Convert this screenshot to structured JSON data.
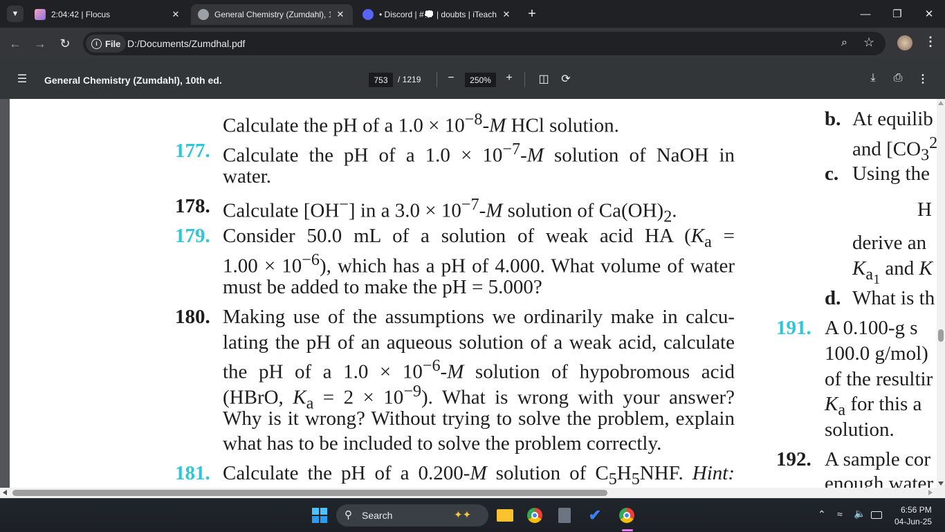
{
  "browser": {
    "tabs": [
      {
        "title": "2:04:42 | Flocus",
        "active": false
      },
      {
        "title": "General Chemistry (Zumdahl), 1",
        "active": true
      },
      {
        "title": "• Discord | #💭 | doubts | iTeach",
        "active": false
      }
    ],
    "new_tab": "+",
    "url_chip": "File",
    "url": "D:/Documents/Zumdhal.pdf"
  },
  "pdf": {
    "title": "General Chemistry (Zumdahl), 10th ed.",
    "current_page": "753",
    "total_pages": "/ 1219",
    "zoom": "250%",
    "zoom_out": "−",
    "zoom_in": "+"
  },
  "page_content": {
    "left": [
      {
        "num": "",
        "num_color": "",
        "html": "Calculate the pH of a 1.0 × 10<sup>−8</sup>-<i>M</i> HCl solution."
      },
      {
        "num": "177.",
        "num_color": "#2ec7d9",
        "html": "Calculate the pH of a 1.0 × 10<sup>−7</sup>-<i>M</i> solution of NaOH in"
      },
      {
        "num": "",
        "num_color": "",
        "html": "water."
      },
      {
        "num": "178.",
        "num_color": "#1e1e1e",
        "html": "Calculate [OH<sup>−</sup>] in a 3.0 × 10<sup>−7</sup>-<i>M</i> solution of Ca(OH)<sub>2</sub>."
      },
      {
        "num": "179.",
        "num_color": "#2ec7d9",
        "html": "Consider 50.0 mL of a solution of weak acid HA (<i>K</i><sub>a</sub> ="
      },
      {
        "num": "",
        "num_color": "",
        "html": "1.00 × 10<sup>−6</sup>), which has a pH of 4.000. What volume of water"
      },
      {
        "num": "",
        "num_color": "",
        "html": "must be added to make the pH = 5.000?"
      },
      {
        "num": "180.",
        "num_color": "#1e1e1e",
        "html": "Making use of the assumptions we ordinarily make in calcu-"
      },
      {
        "num": "",
        "num_color": "",
        "html": "lating the pH of an aqueous solution of a weak acid, calculate"
      },
      {
        "num": "",
        "num_color": "",
        "html": "the pH of a 1.0 × 10<sup>−6</sup>-<i>M</i> solution of hypobromous acid"
      },
      {
        "num": "",
        "num_color": "",
        "html": "(HBrO, <i>K</i><sub>a</sub> = 2 × 10<sup>−9</sup>). What is wrong with your answer?"
      },
      {
        "num": "",
        "num_color": "",
        "html": "Why is it wrong? Without trying to solve the problem, explain"
      },
      {
        "num": "",
        "num_color": "",
        "html": "what has to be included to solve the problem correctly."
      },
      {
        "num": "181.",
        "num_color": "#2ec7d9",
        "html": "Calculate the pH of a 0.200-<i>M</i> solution of C<sub>5</sub>H<sub>5</sub>NHF. <i>Hint:</i>"
      }
    ],
    "right": [
      {
        "num": "b.",
        "html": "At equilib"
      },
      {
        "num": "",
        "html": "and [CO<sub>3</sub><sup>2</sup>"
      },
      {
        "num": "c.",
        "html": "Using the"
      },
      {
        "num": "",
        "html": "H"
      },
      {
        "num": "",
        "html": "derive an"
      },
      {
        "num": "",
        "html": "<i>K</i><sub>a<sub>1</sub></sub> and <i>K</i>"
      },
      {
        "num": "d.",
        "html": "What is th"
      },
      {
        "num": "191.",
        "html": "A 0.100-g s"
      },
      {
        "num": "",
        "html": "100.0 g/mol)"
      },
      {
        "num": "",
        "html": "of the resultir"
      },
      {
        "num": "",
        "html": "<i>K</i><sub>a</sub> for this a"
      },
      {
        "num": "",
        "html": "solution."
      },
      {
        "num": "192.",
        "html": "A sample cor"
      },
      {
        "num": "",
        "html": "enough water"
      }
    ]
  },
  "taskbar": {
    "search_placeholder": "Search",
    "time": "6:56 PM",
    "date": "04-Jun-25"
  },
  "colors": {
    "accent_cyan": "#2ec7d9",
    "chrome_dark": "#202124",
    "pdf_bar": "#323639"
  }
}
